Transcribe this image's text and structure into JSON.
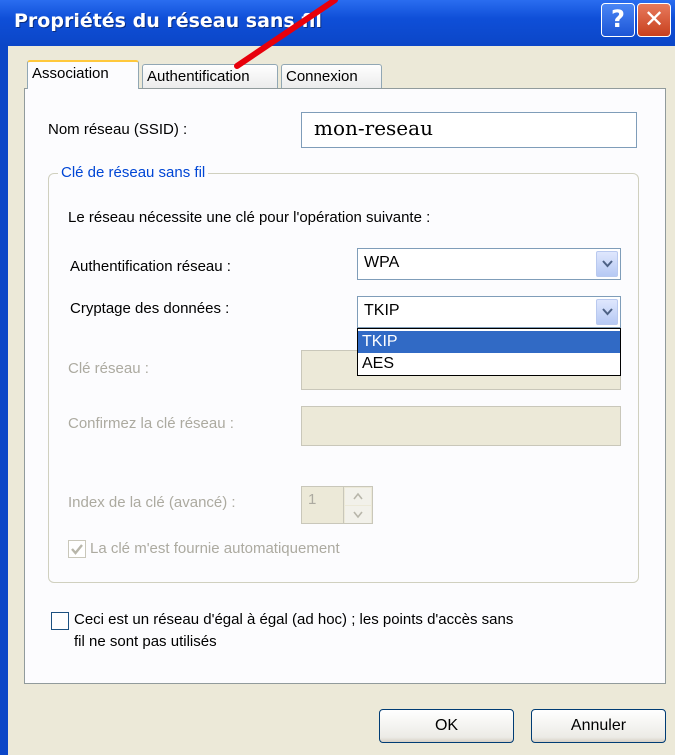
{
  "window": {
    "title": "Propriétés du réseau sans fil",
    "help_glyph": "?",
    "close_glyph": "✕"
  },
  "tabs": [
    {
      "label": "Association",
      "active": true
    },
    {
      "label": "Authentification",
      "active": false
    },
    {
      "label": "Connexion",
      "active": false
    }
  ],
  "ssid": {
    "label": "Nom réseau (SSID) :",
    "value": "mon-reseau"
  },
  "wireless_key": {
    "group_title": "Clé de réseau sans fil",
    "intro": "Le réseau nécessite une clé pour l'opération suivante :",
    "auth_label": "Authentification réseau :",
    "auth_value": "WPA",
    "encryption_label": "Cryptage des données :",
    "encryption_value": "TKIP",
    "encryption_options": [
      "TKIP",
      "AES"
    ],
    "network_key_label": "Clé réseau :",
    "confirm_key_label": "Confirmez la clé réseau :",
    "key_index_label": "Index de la clé (avancé) :",
    "key_index_value": "1",
    "auto_key_label": "La clé m'est fournie automatiquement",
    "auto_key_checked": true
  },
  "adhoc": {
    "line1": "Ceci est un réseau d'égal à égal (ad hoc) ; les points d'accès sans",
    "line2": "fil ne sont pas utilisés",
    "checked": false
  },
  "buttons": {
    "ok": "OK",
    "cancel": "Annuler"
  },
  "colors": {
    "titlebar": "#0b46c7",
    "selection": "#316ac5",
    "annotation_arrow": "#e8000b"
  }
}
